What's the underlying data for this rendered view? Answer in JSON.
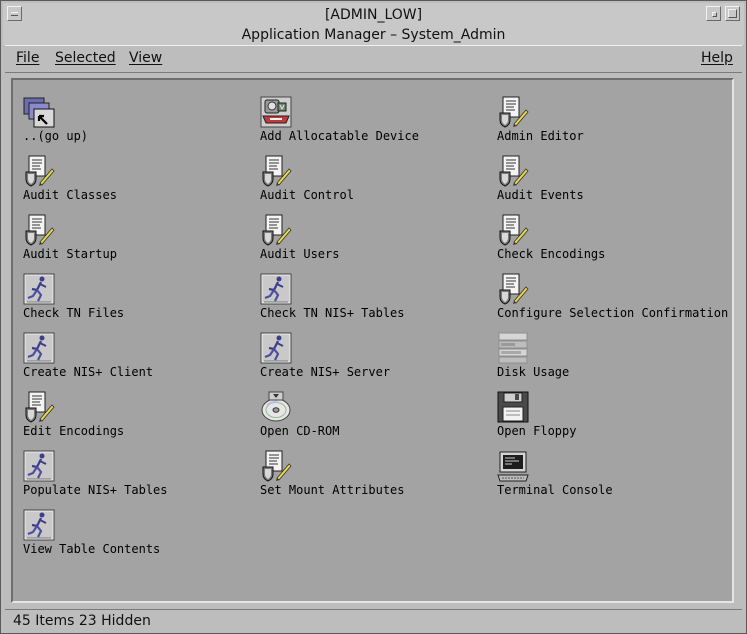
{
  "window": {
    "title": "[ADMIN_LOW]",
    "subtitle": "Application Manager – System_Admin"
  },
  "menubar": {
    "file": "File",
    "selected": "Selected",
    "view": "View",
    "help": "Help"
  },
  "items": [
    {
      "label": "..(go up)",
      "icon": "folder-up-icon"
    },
    {
      "label": "Add Allocatable Device",
      "icon": "device-icon"
    },
    {
      "label": "Admin Editor",
      "icon": "shield-document-icon"
    },
    {
      "label": "Audit Classes",
      "icon": "shield-document-icon"
    },
    {
      "label": "Audit Control",
      "icon": "shield-document-icon"
    },
    {
      "label": "Audit Events",
      "icon": "shield-document-icon"
    },
    {
      "label": "Audit Startup",
      "icon": "shield-document-icon"
    },
    {
      "label": "Audit Users",
      "icon": "shield-document-icon"
    },
    {
      "label": "Check Encodings",
      "icon": "shield-document-icon"
    },
    {
      "label": "Check TN Files",
      "icon": "runner-icon"
    },
    {
      "label": "Check TN NIS+ Tables",
      "icon": "runner-icon"
    },
    {
      "label": "Configure Selection Confirmation",
      "icon": "shield-document-icon"
    },
    {
      "label": "Create NIS+ Client",
      "icon": "runner-icon"
    },
    {
      "label": "Create NIS+ Server",
      "icon": "runner-icon"
    },
    {
      "label": "Disk Usage",
      "icon": "disk-usage-icon"
    },
    {
      "label": "Edit Encodings",
      "icon": "shield-document-icon"
    },
    {
      "label": "Open CD-ROM",
      "icon": "cdrom-icon"
    },
    {
      "label": "Open Floppy",
      "icon": "floppy-icon"
    },
    {
      "label": "Populate NIS+ Tables",
      "icon": "runner-icon"
    },
    {
      "label": "Set Mount Attributes",
      "icon": "shield-document-icon"
    },
    {
      "label": "Terminal Console",
      "icon": "terminal-icon"
    },
    {
      "label": "View Table Contents",
      "icon": "runner-icon"
    }
  ],
  "status": {
    "text": "45 Items 23 Hidden"
  }
}
